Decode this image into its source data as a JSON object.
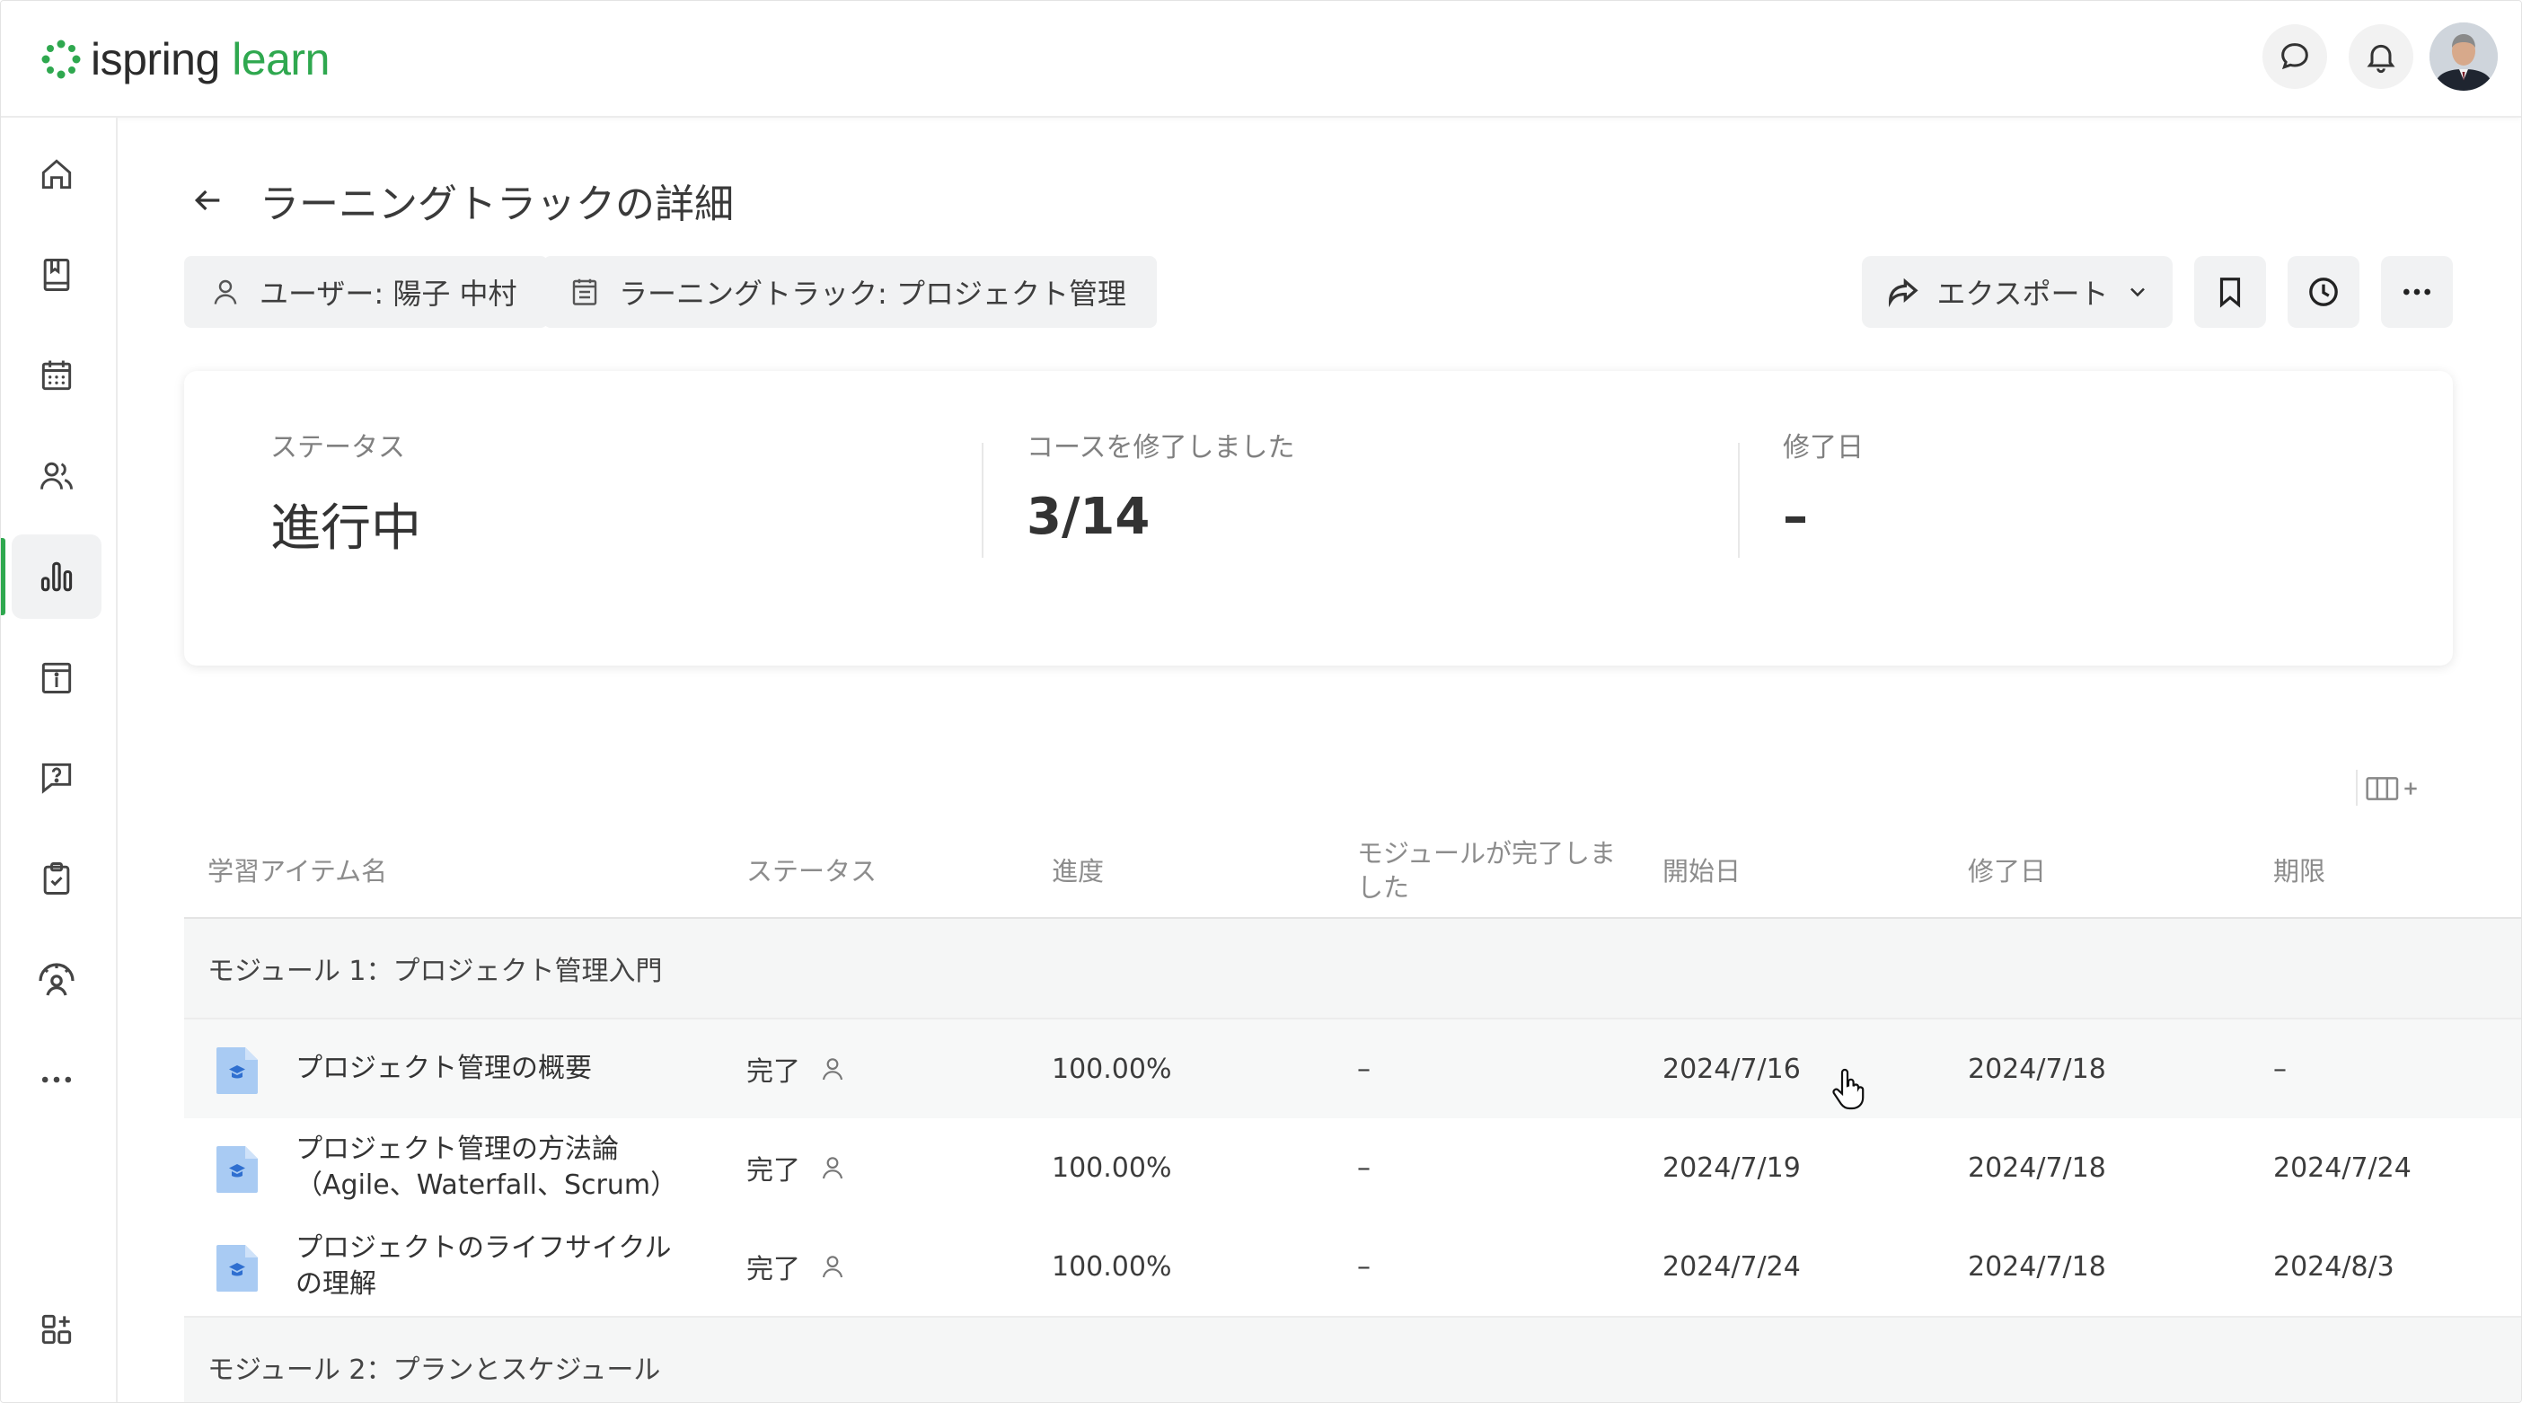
{
  "app": {
    "logo_part1": "ispring",
    "logo_part2": "learn"
  },
  "header": {
    "chat_icon": "chat-bubble-icon",
    "bell_icon": "bell-icon",
    "avatar_alt": "user-avatar"
  },
  "sidebar": {
    "items": [
      {
        "icon": "home-icon"
      },
      {
        "icon": "book-icon"
      },
      {
        "icon": "calendar-icon"
      },
      {
        "icon": "users-icon"
      },
      {
        "icon": "reports-icon",
        "active": true
      },
      {
        "icon": "info-calendar-icon"
      },
      {
        "icon": "question-icon"
      },
      {
        "icon": "clipboard-check-icon"
      },
      {
        "icon": "gauge-user-icon"
      },
      {
        "icon": "more-icon"
      },
      {
        "icon": "apps-add-icon"
      }
    ]
  },
  "page": {
    "title": "ラーニングトラックの詳細",
    "filter_user": "ユーザー: 陽子 中村",
    "filter_track": "ラーニングトラック: プロジェクト管理",
    "export_label": "エクスポート"
  },
  "summary": {
    "status_label": "ステータス",
    "status_value": "進行中",
    "courses_label": "コースを修了しました",
    "courses_value": "3/14",
    "completed_label": "修了日",
    "completed_value": "–"
  },
  "table": {
    "headers": {
      "name": "学習アイテム名",
      "status": "ステータス",
      "progress": "進度",
      "module_done_1": "モジュールが完了しま",
      "module_done_2": "した",
      "start": "開始日",
      "completed": "修了日",
      "due": "期限"
    },
    "groups": [
      {
        "title": "モジュール 1：プロジェクト管理入門"
      },
      {
        "title": "モジュール 2：プランとスケジュール"
      }
    ],
    "rows": [
      {
        "name_1": "プロジェクト管理の概要",
        "name_2": "",
        "status": "完了",
        "progress": "100.00%",
        "module_done": "–",
        "start": "2024/7/16",
        "completed": "2024/7/18",
        "due": "–"
      },
      {
        "name_1": "プロジェクト管理の方法論",
        "name_2": "（Agile、Waterfall、Scrum）",
        "status": "完了",
        "progress": "100.00%",
        "module_done": "–",
        "start": "2024/7/19",
        "completed": "2024/7/18",
        "due": "2024/7/24"
      },
      {
        "name_1": "プロジェクトのライフサイクル",
        "name_2": "の理解",
        "status": "完了",
        "progress": "100.00%",
        "module_done": "–",
        "start": "2024/7/24",
        "completed": "2024/7/18",
        "due": "2024/8/3"
      }
    ]
  },
  "colors": {
    "accent": "#2fa84f",
    "file_icon": "#a9cbf3"
  }
}
